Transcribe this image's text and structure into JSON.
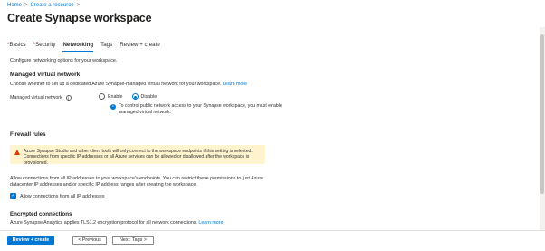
{
  "breadcrumb": {
    "items": [
      "Home",
      "Create a resource"
    ],
    "separator": ">"
  },
  "page": {
    "title": "Create Synapse workspace",
    "more": "···"
  },
  "tabs": [
    {
      "label": "Basics",
      "required": true,
      "active": false
    },
    {
      "label": "Security",
      "required": true,
      "active": false
    },
    {
      "label": "Networking",
      "required": false,
      "active": true
    },
    {
      "label": "Tags",
      "required": false,
      "active": false
    },
    {
      "label": "Review + create",
      "required": false,
      "active": false
    }
  ],
  "intro": "Configure networking options for your workspace.",
  "managed_vnet": {
    "heading": "Managed virtual network",
    "description": "Choose whether to set up a dedicated Azure Synapse-managed virtual network for your workspace.",
    "learn_more": "Learn more",
    "field_label": "Managed virtual network",
    "options": [
      "Enable",
      "Disable"
    ],
    "selected": "Disable",
    "note_line1": "To control public network access to your Synapse workspace, you must enable",
    "note_line2": "managed virtual network."
  },
  "firewall": {
    "heading": "Firewall rules",
    "warning_line1": "Azure Synapse Studio and other client tools will only connect to the workspace endpoints if this setting is selected.",
    "warning_line2": "Connections from specific IP addresses or all Azure services can be allowed or disallowed after the workspace is provisioned.",
    "desc_line1": "Allow connections from all IP addresses to your workspace's endpoints. You can restrict these permissions to just Azure",
    "desc_line2": "datacenter IP addresses and/or specific IP address ranges after creating the workspace.",
    "checkbox_label": "Allow connections from all IP addresses",
    "checkbox_checked": true
  },
  "encrypted": {
    "heading": "Encrypted connections",
    "description": "Azure Synapse Analytics applies TLS1.2 encryption protocol for all network connections.",
    "learn_more": "Learn more"
  },
  "footer": {
    "review_create": "Review + create",
    "previous": "< Previous",
    "next": "Next: Tags >"
  },
  "colors": {
    "accent": "#0078d4",
    "warning_bg": "#fff4ce",
    "warning_icon": "#d83b01"
  }
}
